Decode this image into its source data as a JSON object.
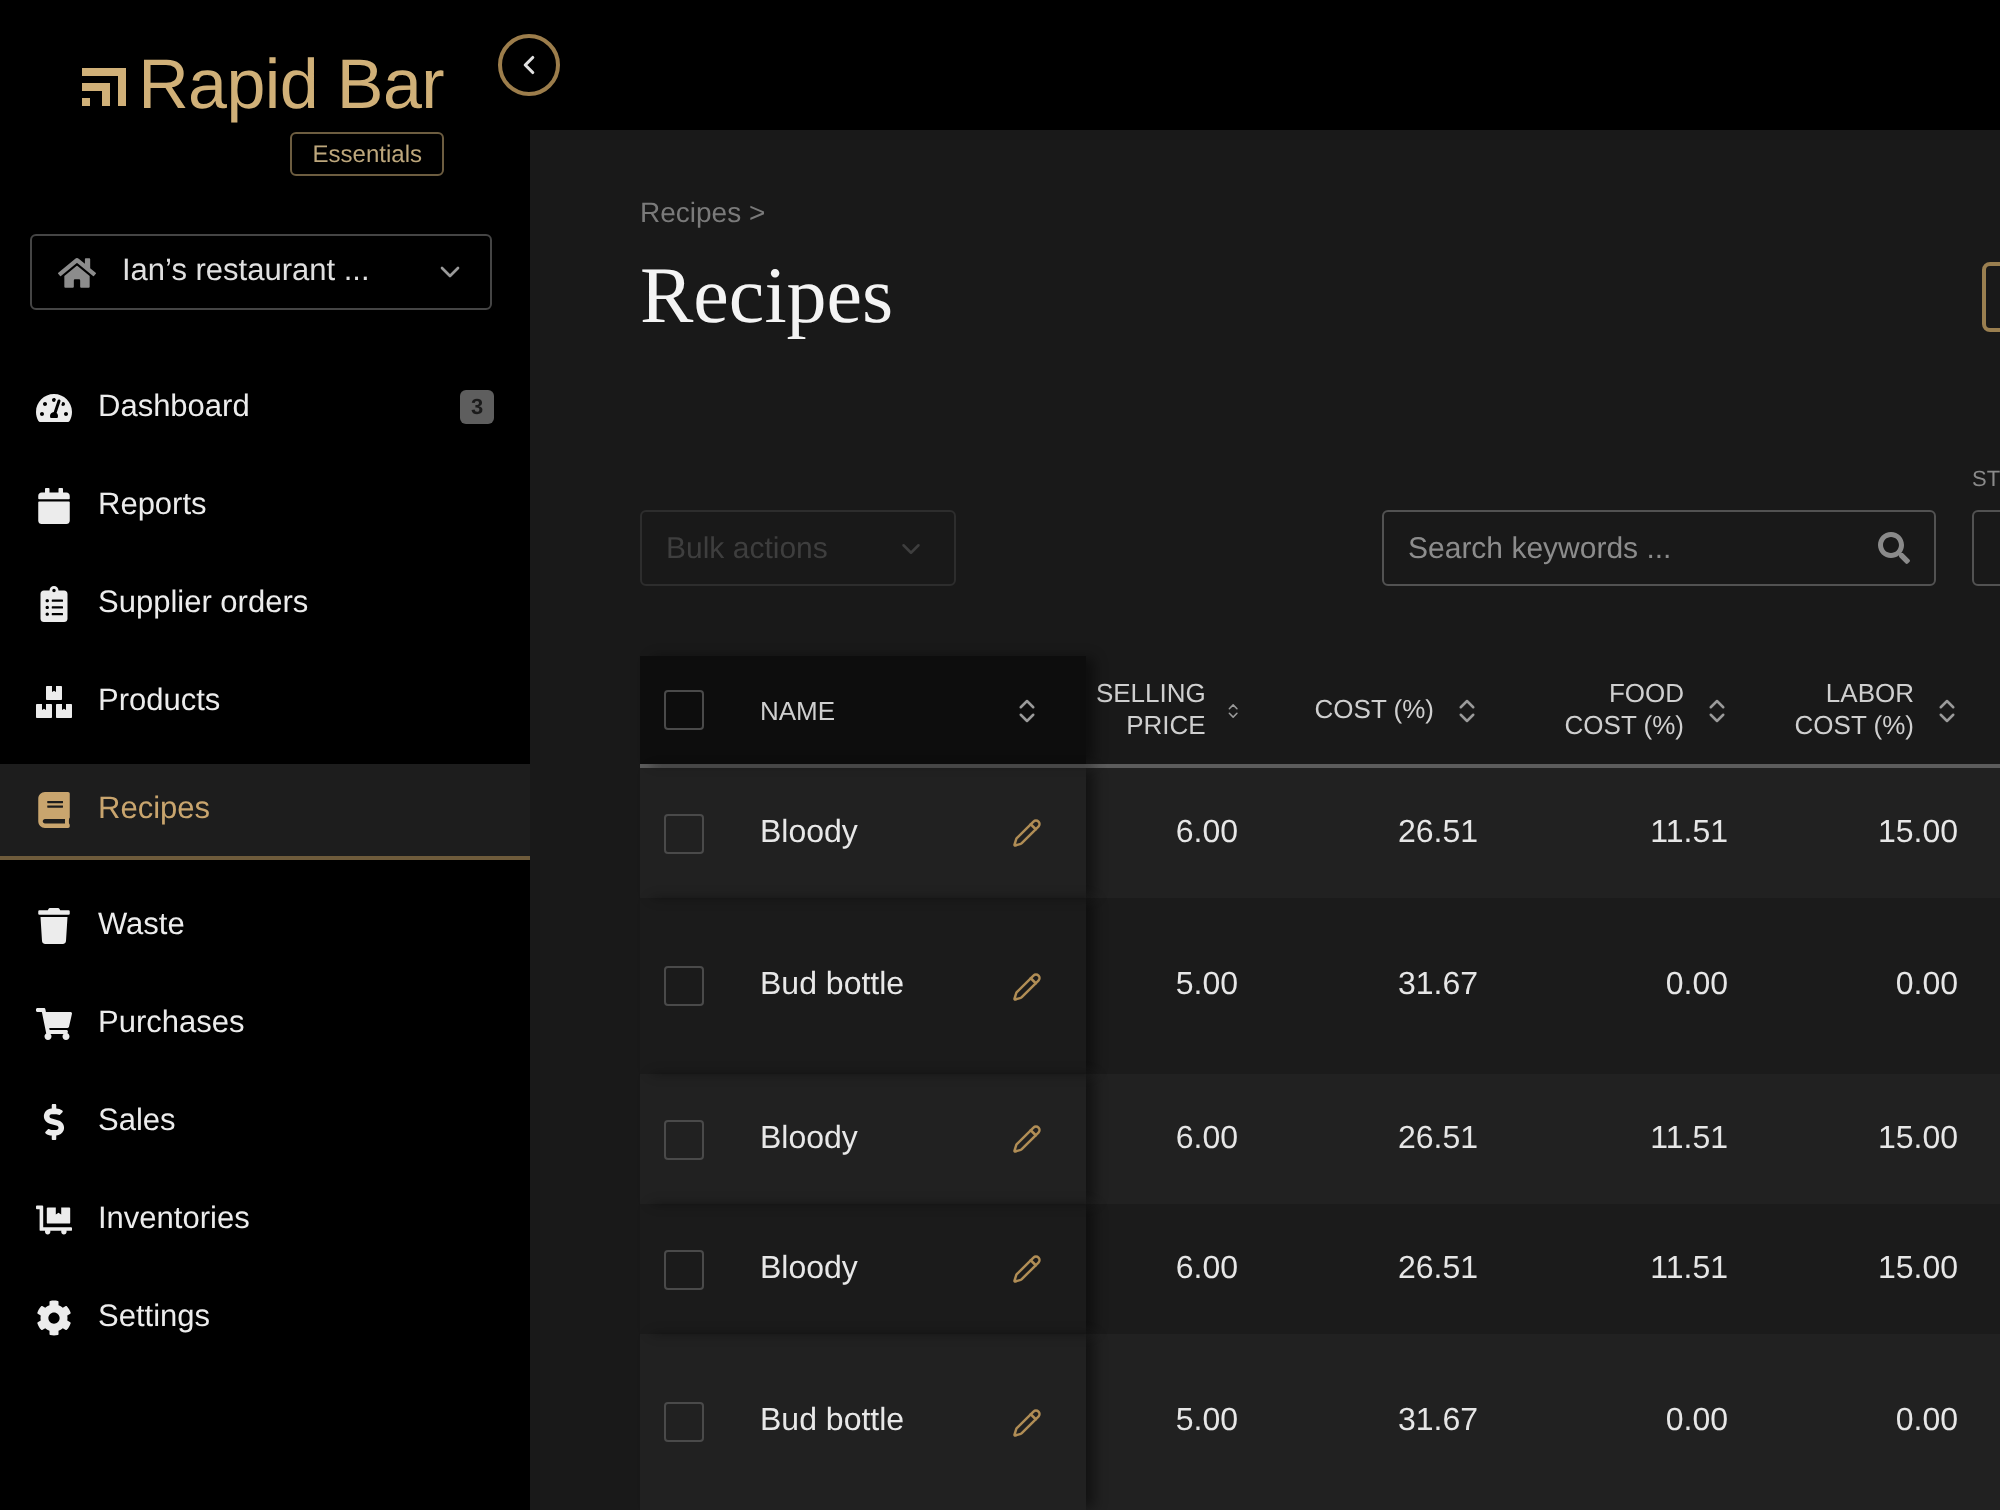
{
  "sidebar": {
    "logo": {
      "wordmark": "Rapid Bar",
      "edition": "Essentials"
    },
    "restaurant_select": {
      "value": "Ian’s restaurant ..."
    },
    "nav": [
      {
        "label": "Dashboard",
        "badge": "3",
        "selected": false
      },
      {
        "label": "Reports",
        "selected": false
      },
      {
        "label": "Supplier orders",
        "selected": false
      },
      {
        "label": "Products",
        "selected": false
      },
      {
        "label": "Recipes",
        "selected": true
      },
      {
        "label": "Waste",
        "selected": false
      },
      {
        "label": "Purchases",
        "selected": false
      },
      {
        "label": "Sales",
        "selected": false
      },
      {
        "label": "Inventories",
        "selected": false
      },
      {
        "label": "Settings",
        "selected": false
      }
    ]
  },
  "page": {
    "breadcrumb": "Recipes >",
    "title": "Recipes"
  },
  "toolbar": {
    "bulk_actions": {
      "label": "Bulk actions",
      "disabled": true
    },
    "search": {
      "placeholder": "Search keywords ..."
    },
    "filter": {
      "label": "ST"
    }
  },
  "table": {
    "select_all": {
      "checked": false
    },
    "columns": [
      "NAME",
      "SELLING PRICE",
      "COST (%)",
      "FOOD COST (%)",
      "LABOR COST (%)"
    ],
    "rows": [
      {
        "checked": false,
        "name": "Bloody",
        "cells": [
          "6.00",
          "26.51",
          "11.51",
          "15.00"
        ]
      },
      {
        "checked": false,
        "name": "Bud bottle",
        "cells": [
          "5.00",
          "31.67",
          "0.00",
          "0.00"
        ]
      },
      {
        "checked": false,
        "name": "Bloody",
        "cells": [
          "6.00",
          "26.51",
          "11.51",
          "15.00"
        ]
      },
      {
        "checked": false,
        "name": "Bloody",
        "cells": [
          "6.00",
          "26.51",
          "11.51",
          "15.00"
        ]
      },
      {
        "checked": false,
        "name": "Bud bottle",
        "cells": [
          "5.00",
          "31.67",
          "0.00",
          "0.00"
        ]
      }
    ]
  }
}
